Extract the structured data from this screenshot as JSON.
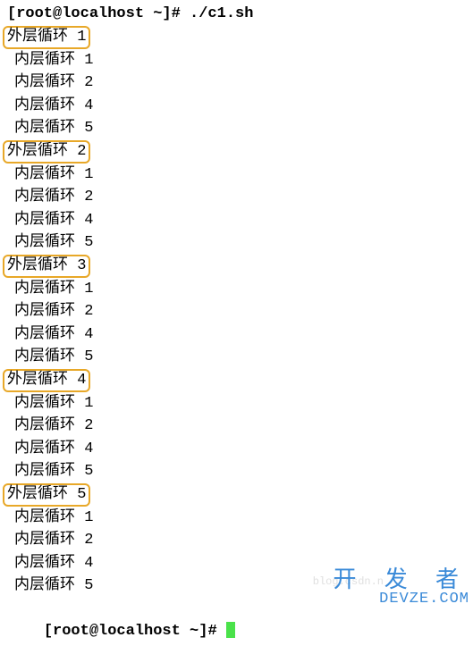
{
  "terminal": {
    "prompt_start": "[root@localhost ~]# ./c1.sh",
    "prompt_end": "[root@localhost ~]# ",
    "groups": [
      {
        "outer": "外层循环 1",
        "inner": [
          "内层循环 1",
          "内层循环 2",
          "内层循环 4",
          "内层循环 5"
        ]
      },
      {
        "outer": "外层循环 2",
        "inner": [
          "内层循环 1",
          "内层循环 2",
          "内层循环 4",
          "内层循环 5"
        ]
      },
      {
        "outer": "外层循环 3",
        "inner": [
          "内层循环 1",
          "内层循环 2",
          "内层循环 4",
          "内层循环 5"
        ]
      },
      {
        "outer": "外层循环 4",
        "inner": [
          "内层循环 1",
          "内层循环 2",
          "内层循环 4",
          "内层循环 5"
        ]
      },
      {
        "outer": "外层循环 5",
        "inner": [
          "内层循环 1",
          "内层循环 2",
          "内层循环 4",
          "内层循环 5"
        ]
      }
    ]
  },
  "watermark": {
    "cn": "开 发 者",
    "en": "DEVZE.COM",
    "faint": "blog.csdn.n"
  }
}
